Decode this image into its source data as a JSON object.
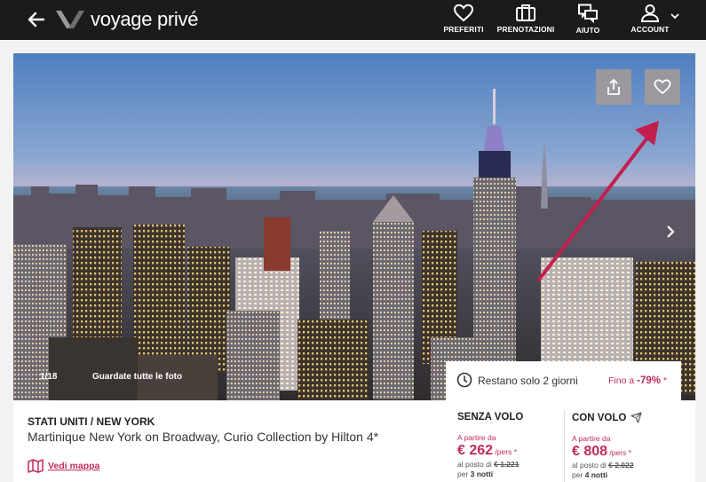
{
  "header": {
    "brand": "voyage privé",
    "nav": [
      {
        "label": "PREFERITI",
        "icon": "heart-icon"
      },
      {
        "label": "PRENOTAZIONI",
        "icon": "suitcase-icon"
      },
      {
        "label": "AIUTO",
        "icon": "chat-icon"
      },
      {
        "label": "ACCOUNT",
        "icon": "user-icon"
      }
    ]
  },
  "gallery": {
    "counter": "1/18",
    "all_photos": "Guardate tutte le foto"
  },
  "countdown": {
    "text": "Restano solo 2 giorni",
    "discount_prefix": "Fino a ",
    "discount_value": "-79%",
    "discount_suffix": " *"
  },
  "offer": {
    "destination": "STATI UNITI / NEW YORK",
    "hotel_name": "Martinique New York on Broadway, Curio Collection by Hilton 4*",
    "map_link": "Vedi mappa"
  },
  "prices": [
    {
      "heading": "SENZA VOLO",
      "from": "A partire da",
      "price": "€ 262",
      "unit": " /pers *",
      "instead_prefix": "al posto di ",
      "instead_value": "€ 1.221",
      "nights_prefix": "per ",
      "nights_value": "3 notti"
    },
    {
      "heading": "CON VOLO",
      "from": "A partire da",
      "price": "€ 808",
      "unit": " /pers *",
      "instead_prefix": "al posto di ",
      "instead_value": "€ 2.022",
      "nights_prefix": "per ",
      "nights_value": "4 notti"
    }
  ],
  "colors": {
    "accent": "#c12a5b",
    "header_bg": "#1b1b1b"
  }
}
